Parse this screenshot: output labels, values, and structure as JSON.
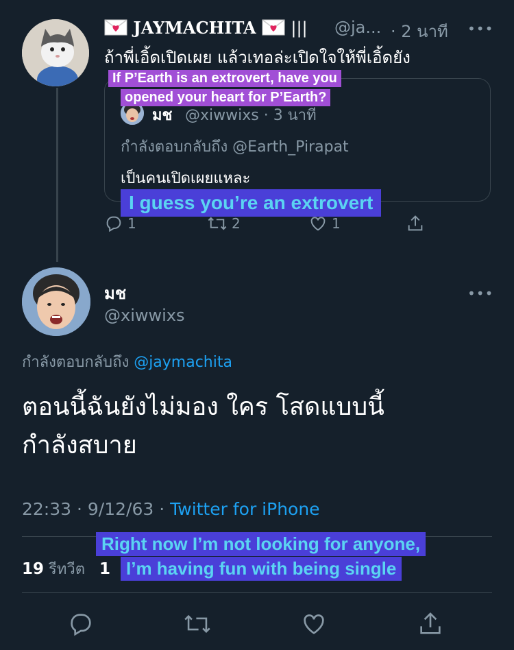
{
  "tweet1": {
    "display_name": "JAYMACHITA",
    "name_suffix": "|||",
    "handle": "@ja...",
    "time": "· 2 นาที",
    "text": "ถ้าพี่เอิ้ดเปิดเผย แล้วเทอล่ะเปิดใจให้พี่เอิ้ดยัง",
    "caption_line1": "If P’Earth is an extrovert,  have you",
    "caption_line2": "opened your heart for P’Earth?",
    "more": "•••",
    "actions": {
      "reply": "1",
      "retweet": "2",
      "like": "1"
    }
  },
  "quoted": {
    "name": "มช",
    "handle": "@xiwwixs · 3 นาที",
    "replying_to": "กำลังตอบกลับถึง @Earth_Pirapat",
    "text": "เป็นคนเปิดเผยแหละ",
    "caption": "I guess you’re an extrovert"
  },
  "tweet2": {
    "name": "มช",
    "handle": "@xiwwixs",
    "more": "•••",
    "replying_prefix": "กำลังตอบกลับถึง ",
    "replying_handle": "@jaymachita",
    "text": "ตอนนี้ฉันยังไม่มอง ใคร โสดแบบนี้\nกำลังสบาย",
    "meta_time": "22:33 · 9/12/63 · ",
    "meta_source": "Twitter for iPhone",
    "caption_line1": "Right now I’m not looking for anyone,",
    "caption_line2": "I’m having fun with being single",
    "retweets_count": "19",
    "retweets_label": "รีทวีต",
    "likes_count_partial": "1"
  },
  "colors": {
    "background": "#15202b",
    "muted": "#8899a6",
    "link": "#1da1f2",
    "caption_purple": "#a14fd6",
    "caption_blue": "#4a3fd8",
    "caption_blue_text": "#5bd4f2"
  }
}
